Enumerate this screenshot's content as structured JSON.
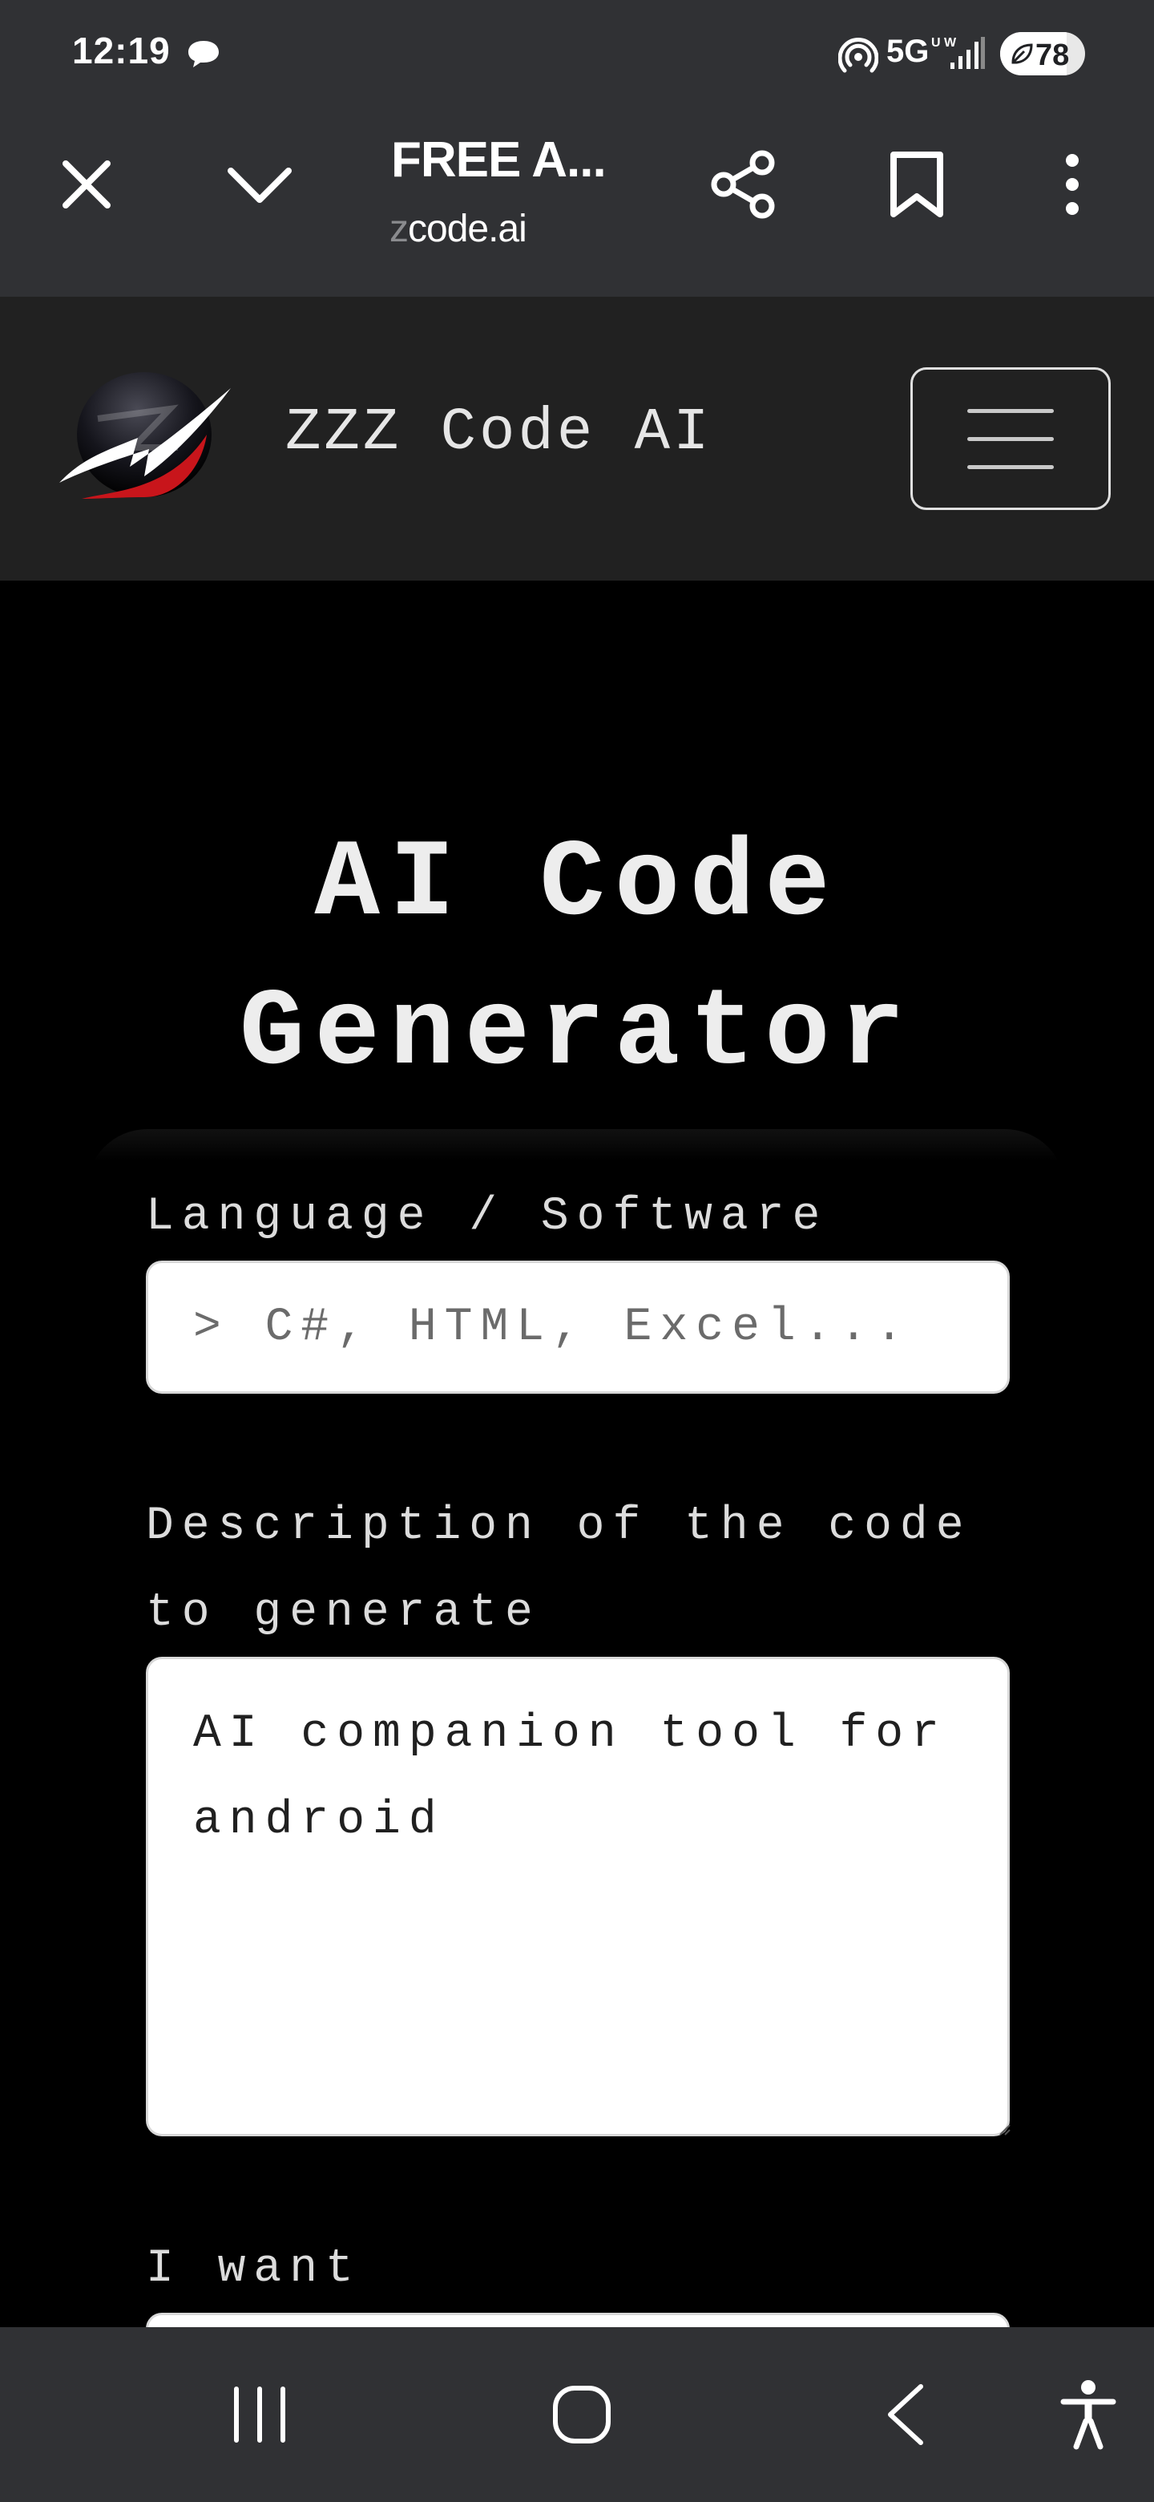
{
  "status_bar": {
    "time": "12:19",
    "network": "5G",
    "network_sub": "U W",
    "battery_percent": "78"
  },
  "browser": {
    "title": "FREE A...",
    "url_faded": "z",
    "url": "code.ai"
  },
  "site": {
    "brand": "ZZZ Code AI"
  },
  "main": {
    "heading_line1": "AI Code",
    "heading_line2": "Generator",
    "form": {
      "language_label": "Language / Software",
      "language_placeholder": "> C#, HTML, Excel...",
      "language_value": "",
      "description_label_line1": "Description of the code",
      "description_label_line2": "to generate",
      "description_value": "AI companion tool for android",
      "want_label": "I want"
    }
  },
  "colors": {
    "status_bg": "#303134",
    "header_bg": "#212121",
    "page_bg": "#000000",
    "logo_red": "#c8151b"
  }
}
